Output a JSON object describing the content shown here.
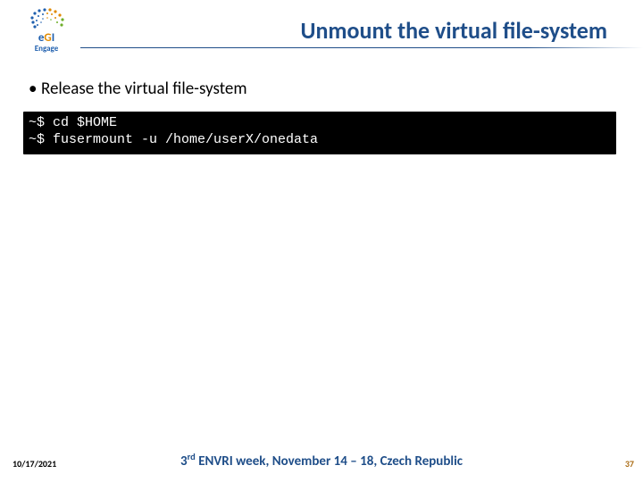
{
  "logo": {
    "line1_e": "e",
    "line1_g": "G",
    "line1_i": "I",
    "sub": "Engage"
  },
  "title": "Unmount the virtual file-system",
  "bullet1": "Release the virtual file-system",
  "code_line1": "~$ cd $HOME",
  "code_line2": "~$ fusermount -u /home/userX/onedata",
  "footer": {
    "date": "10/17/2021",
    "center_pre": "3",
    "center_sup": "rd",
    "center_post": " ENVRI week,  November 14 – 18, Czech Republic",
    "page": "37"
  }
}
